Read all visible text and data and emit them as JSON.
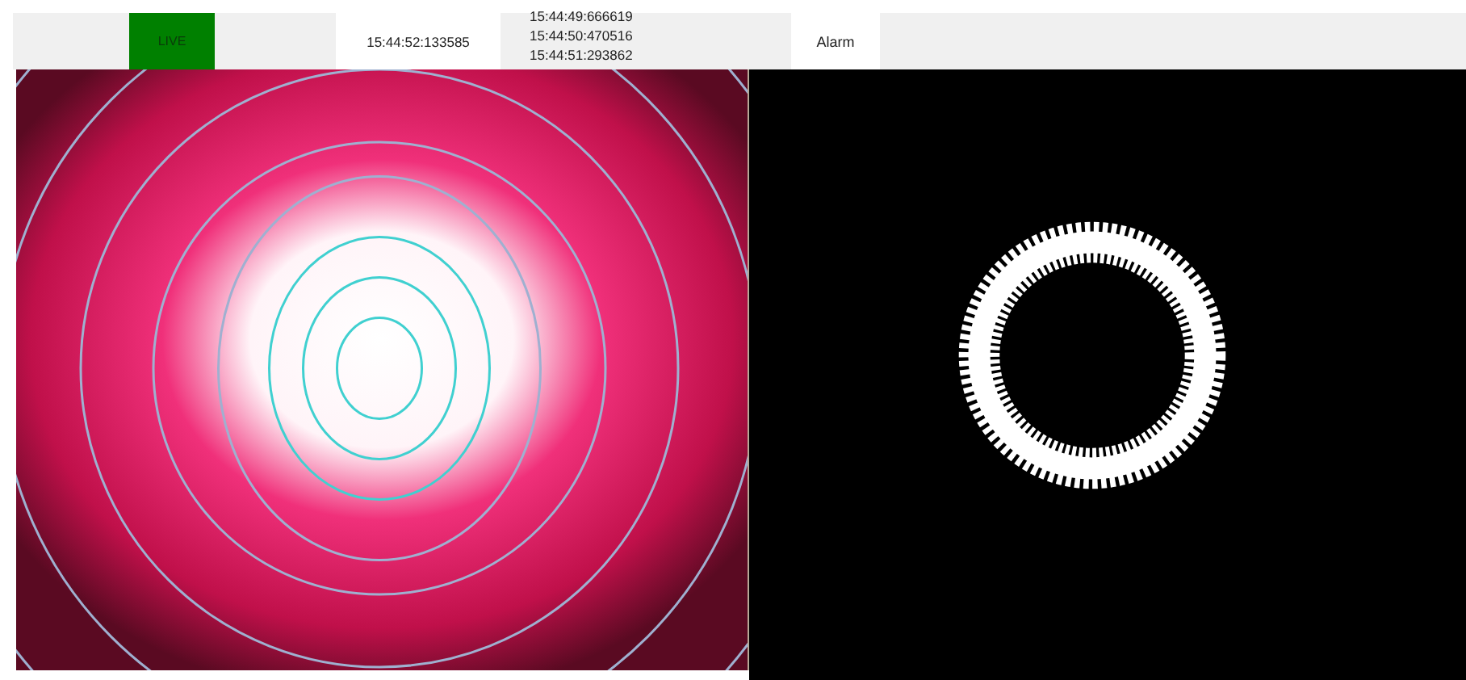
{
  "toolbar": {
    "live": {
      "label": "LIVE",
      "active": true
    },
    "current_time": "15:44:52:133585",
    "recent_times": [
      "15:44:49:666619",
      "15:44:50:470516",
      "15:44:51:293862"
    ],
    "alarm": {
      "label": "Alarm",
      "active": false
    }
  }
}
